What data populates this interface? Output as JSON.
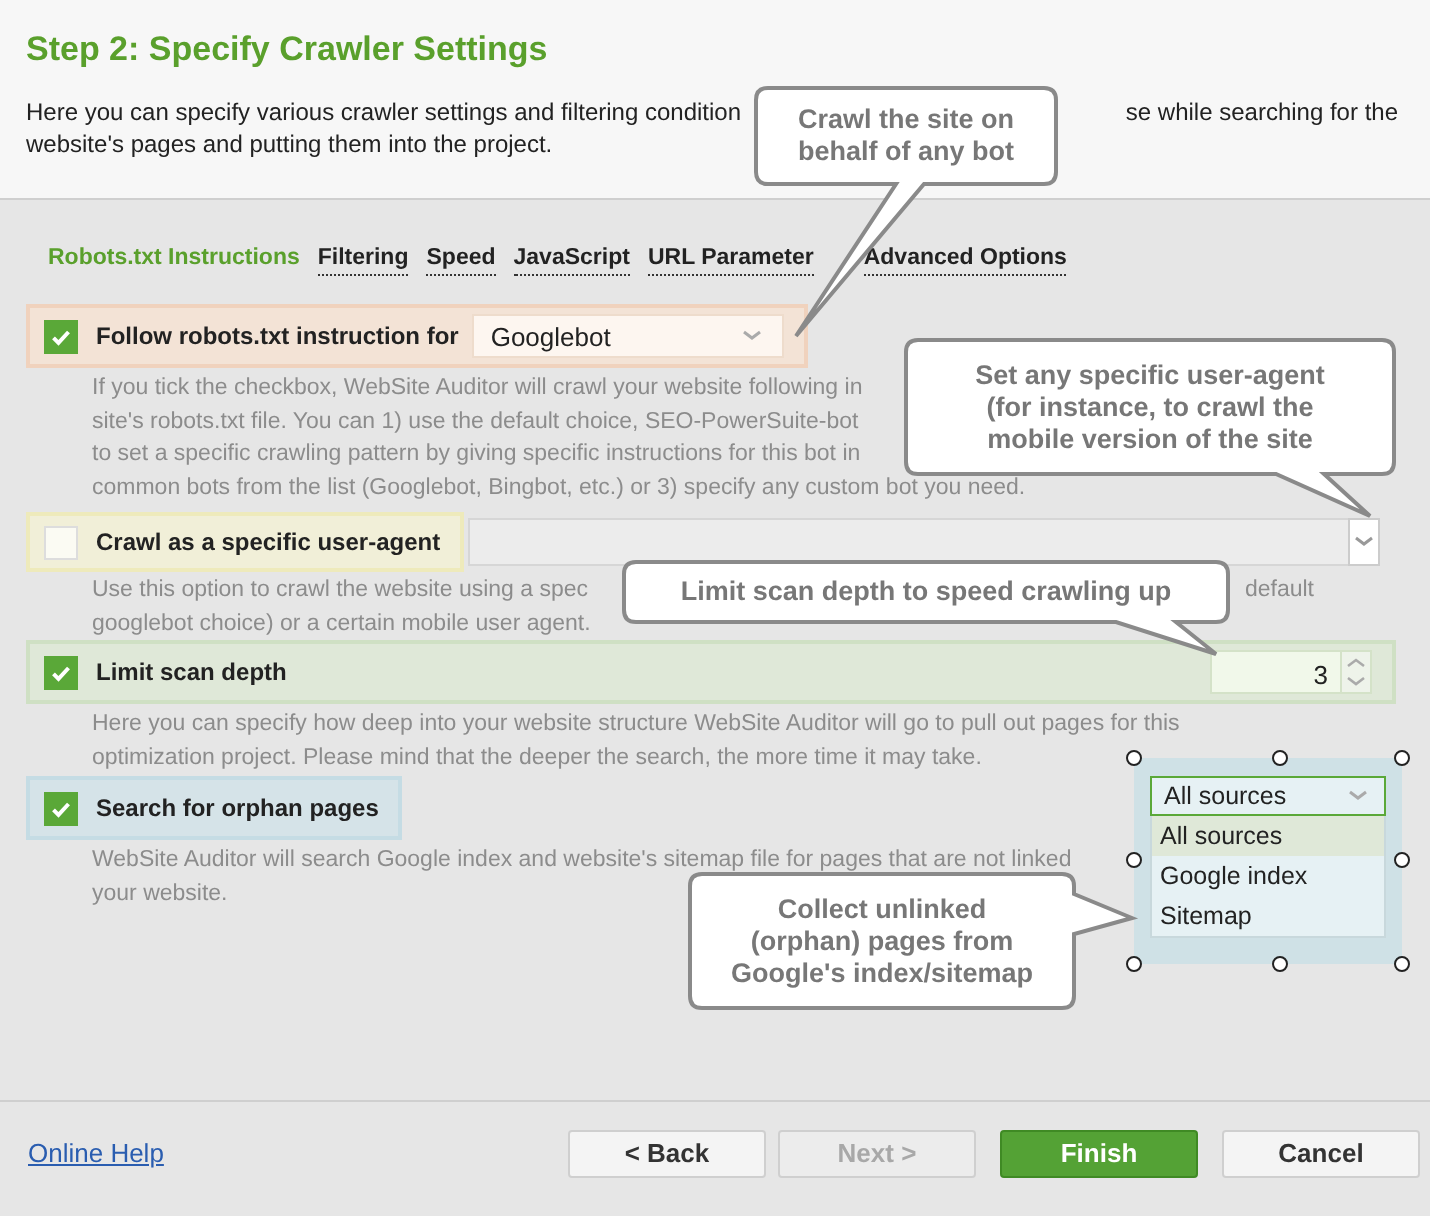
{
  "title": "Step 2: Specify Crawler Settings",
  "intro": [
    {
      "text": "Here you can specify various crawler settings and filtering condition",
      "after": "se while searching for the"
    },
    {
      "text": "website's pages and putting them into the project."
    }
  ],
  "tabs": [
    {
      "label": "Robots.txt Instructions",
      "selected": true
    },
    {
      "label": "Filtering",
      "selected": false
    },
    {
      "label": "Speed",
      "selected": false
    },
    {
      "label": "JavaScript",
      "selected": false
    },
    {
      "label": "URL Parameter",
      "selected": false
    },
    {
      "label": "Advanced Options",
      "selected": false
    }
  ],
  "options": [
    {
      "label": "Follow robots.txt instruction for",
      "checked": true,
      "color": "#f3e3d6",
      "control": {
        "kind": "dropdown",
        "value": "Googlebot"
      },
      "description": [
        {
          "text": "If you tick the checkbox, WebSite Auditor will crawl your website following in"
        },
        {
          "text": "site's robots.txt file. You can 1) use the default choice, SEO-PowerSuite-bot"
        },
        {
          "text": "to set a specific crawling pattern by giving specific instructions for this bot in"
        },
        {
          "text": "common bots from the list (Googlebot, Bingbot, etc.) or 3) specify any custom bot you need."
        }
      ]
    },
    {
      "label": "Crawl as a specific user-agent",
      "checked": false,
      "color": "#f1efd8",
      "control": {
        "kind": "wide-dropdown"
      },
      "description": [
        {
          "text": "Use this option to crawl the website using a spec",
          "after": "default"
        },
        {
          "text": "googlebot choice) or a certain mobile user agent."
        }
      ]
    },
    {
      "label": "Limit scan depth",
      "checked": true,
      "color": "#dfe8d8",
      "control": {
        "kind": "spinner",
        "value": "3"
      },
      "description": [
        {
          "text": "Here you can specify how deep into your website structure WebSite Auditor will go to pull out pages for this"
        },
        {
          "text": "optimization project. Please mind that the deeper the search, the more time it may take."
        }
      ]
    },
    {
      "label": "Search for orphan pages",
      "checked": true,
      "color": "#d5e3e8",
      "control": {
        "kind": "source-dropdown",
        "value": "All sources",
        "expanded": true,
        "options": [
          {
            "label": "All sources",
            "selected": true
          },
          {
            "label": "Google index",
            "selected": false
          },
          {
            "label": "Sitemap",
            "selected": false
          }
        ]
      },
      "description": [
        {
          "text": "WebSite Auditor will search Google index and website's sitemap file for pages that are not linked"
        },
        {
          "text": "your website."
        }
      ]
    }
  ],
  "callouts": [
    "Crawl the site on behalf of any bot",
    "Set any specific user-agent (for instance, to crawl the mobile version of the site",
    "Limit scan depth to speed crawling up",
    "Collect unlinked (orphan) pages from Google's index/sitemap"
  ],
  "help_link": "Online Help",
  "buttons": [
    {
      "label": "< Back",
      "kind": "normal",
      "disabled": false
    },
    {
      "label": "Next >",
      "kind": "normal",
      "disabled": true
    },
    {
      "label": "Finish",
      "kind": "primary",
      "disabled": false
    },
    {
      "label": "Cancel",
      "kind": "normal",
      "disabled": false
    }
  ]
}
